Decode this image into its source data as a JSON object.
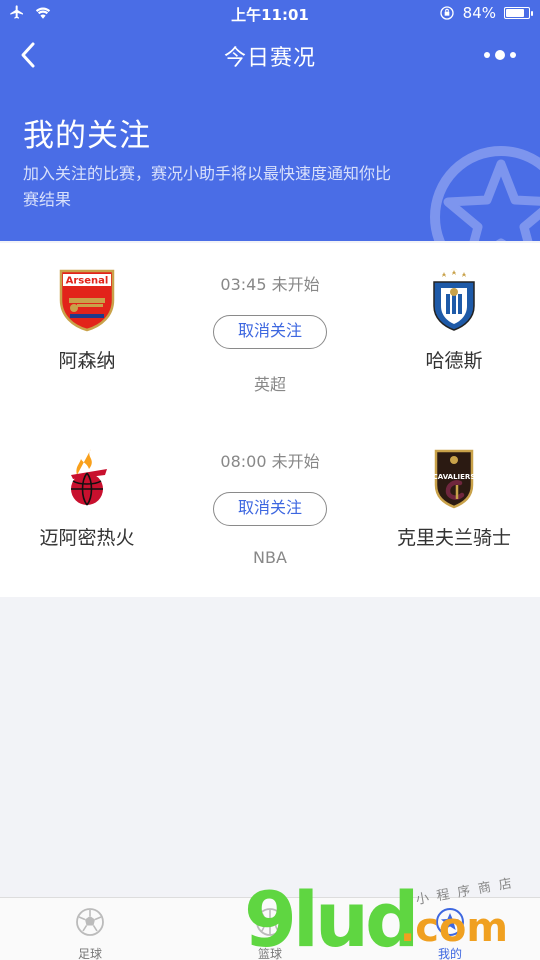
{
  "status_bar": {
    "time": "上午11:01",
    "battery_text": "84%",
    "battery_level": 0.84,
    "icons": [
      "airplane-icon",
      "wifi-icon",
      "rotation-lock-icon",
      "battery-icon"
    ]
  },
  "nav": {
    "title": "今日赛况",
    "back_icon": "chevron-left-icon",
    "more_icon": "more-dots-icon"
  },
  "hero": {
    "title": "我的关注",
    "description": "加入关注的比赛，赛况小助手将以最快速度通知你比赛结果",
    "icon": "star-icon"
  },
  "matches": [
    {
      "home": {
        "name": "阿森纳",
        "logo": "arsenal-crest",
        "logo_text": "Arsenal"
      },
      "away": {
        "name": "哈德斯",
        "logo": "huddersfield-crest"
      },
      "time": "03:45 未开始",
      "unfollow_label": "取消关注",
      "league": "英超"
    },
    {
      "home": {
        "name": "迈阿密热火",
        "logo": "miami-heat-logo"
      },
      "away": {
        "name": "克里夫兰骑士",
        "logo": "cleveland-cavaliers-logo",
        "logo_text": "CAVALIERS"
      },
      "time": "08:00 未开始",
      "unfollow_label": "取消关注",
      "league": "NBA"
    }
  ],
  "tabbar": {
    "tabs": [
      {
        "label": "足球",
        "icon": "football-icon",
        "active": false
      },
      {
        "label": "篮球",
        "icon": "basketball-icon",
        "active": false
      },
      {
        "label": "我的",
        "icon": "star-badge-icon",
        "active": true
      }
    ]
  },
  "watermark": {
    "main": "9lud",
    "suffix": ".com",
    "tagline": "小程序商店"
  },
  "colors": {
    "header_blue": "#4a6de6",
    "accent_blue": "#3d67e0",
    "page_bg": "#f2f3f7",
    "arsenal_red": "#e2231a",
    "heat_red": "#c8102e",
    "cavs_wine": "#6f263d"
  }
}
